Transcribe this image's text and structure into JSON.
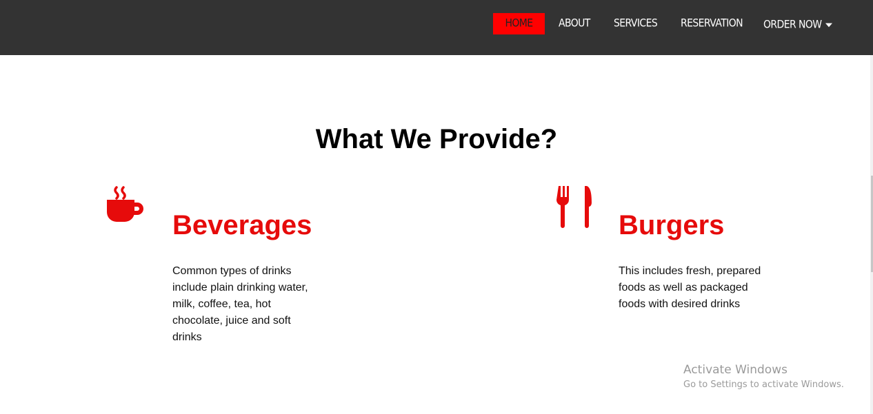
{
  "nav": {
    "items": [
      {
        "label": "HOME"
      },
      {
        "label": "ABOUT"
      },
      {
        "label": "SERVICES"
      },
      {
        "label": "RESERVATION"
      },
      {
        "label": "ORDER NOW"
      }
    ],
    "active_color": "#ff0000",
    "bar_color": "#333333"
  },
  "section": {
    "title": "What We Provide?"
  },
  "services": [
    {
      "icon": "coffee-cup-icon",
      "title": "Beverages",
      "description": "Common types of drinks include plain drinking water, milk, coffee, tea, hot chocolate, juice and soft drinks"
    },
    {
      "icon": "fork-knife-icon",
      "title": "Burgers",
      "description": "This includes fresh, prepared foods as well as packaged foods with desired drinks"
    }
  ],
  "accent_color": "#e60b0b",
  "watermark": {
    "title": "Activate Windows",
    "subtitle": "Go to Settings to activate Windows."
  }
}
